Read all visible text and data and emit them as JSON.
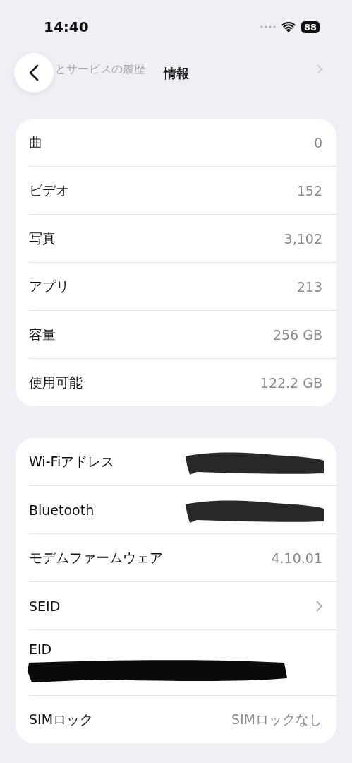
{
  "status_bar": {
    "time": "14:40",
    "battery": "88"
  },
  "nav": {
    "title": "情報",
    "behind_text": "とサービスの履歴"
  },
  "sections": [
    {
      "rows": [
        {
          "kind": "value",
          "label": "曲",
          "value": "0"
        },
        {
          "kind": "value",
          "label": "ビデオ",
          "value": "152"
        },
        {
          "kind": "value",
          "label": "写真",
          "value": "3,102"
        },
        {
          "kind": "value",
          "label": "アプリ",
          "value": "213"
        },
        {
          "kind": "value",
          "label": "容量",
          "value": "256 GB"
        },
        {
          "kind": "value",
          "label": "使用可能",
          "value": "122.2 GB"
        }
      ]
    },
    {
      "rows": [
        {
          "kind": "redacted",
          "label": "Wi-Fiアドレス"
        },
        {
          "kind": "redacted",
          "label": "Bluetooth"
        },
        {
          "kind": "value",
          "label": "モデムファームウェア",
          "value": "4.10.01"
        },
        {
          "kind": "chevron",
          "label": "SEID"
        },
        {
          "kind": "stacked-redacted",
          "label": "EID"
        },
        {
          "kind": "value",
          "label": "SIMロック",
          "value": "SIMロックなし"
        }
      ]
    }
  ]
}
